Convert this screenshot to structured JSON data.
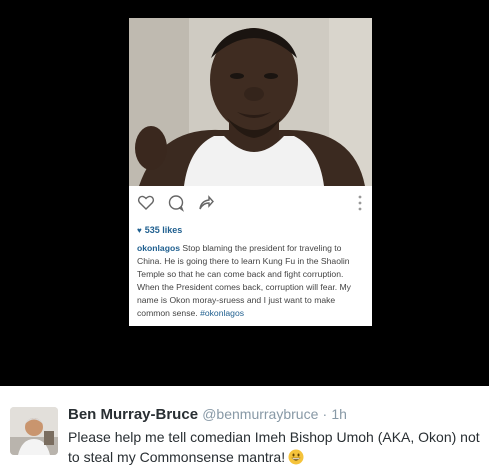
{
  "post": {
    "likes": "535 likes",
    "username": "okonlagos",
    "caption": "Stop blaming the president for traveling to China. He is going there to learn Kung Fu in the Shaolin Temple so that he can come back and fight corruption. When the President comes back, corruption will fear. My name is Okon moray-sruess and I just want to make common sense.",
    "hashtag": "#okonlagos",
    "icons": [
      "heart-outline-icon",
      "comment-bubble-icon",
      "share-arrow-icon",
      "more-vertical-icon"
    ],
    "accent_color": "#1f5f8f"
  },
  "tweet": {
    "author_name": "Ben Murray-Bruce",
    "handle": "@benmurraybruce",
    "separator": "·",
    "time": "1h",
    "text": "Please help me tell comedian Imeh Bishop Umoh (AKA, Okon) not to steal my Commonsense mantra!",
    "emoji": "grinning-face-emoji"
  }
}
